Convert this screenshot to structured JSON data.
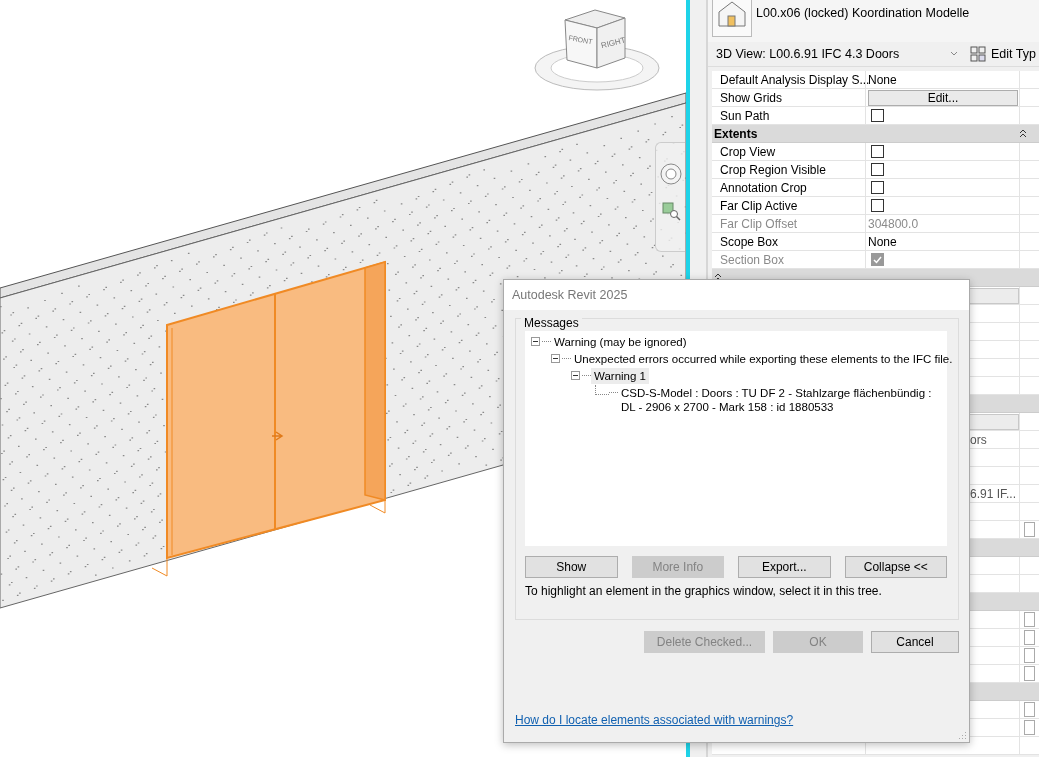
{
  "viewport": {
    "viewcube_faces": [
      "FRONT",
      "RIGHT"
    ]
  },
  "properties": {
    "view_name": "L00.x06 (locked) Koordination Modelle",
    "type_selector": "3D View: L00.6.91 IFC 4.3 Doors",
    "edit_type": "Edit Typ",
    "rows": [
      {
        "kind": "text",
        "label": "Default Analysis Display S...",
        "value": "None",
        "disabled": false
      },
      {
        "kind": "button",
        "label": "Show Grids",
        "value": "Edit...",
        "disabled": false
      },
      {
        "kind": "checkbox",
        "label": "Sun Path",
        "checked": false,
        "disabled": false
      },
      {
        "kind": "section",
        "label": "Extents"
      },
      {
        "kind": "checkbox",
        "label": "Crop View",
        "checked": false,
        "disabled": false
      },
      {
        "kind": "checkbox",
        "label": "Crop Region Visible",
        "checked": false,
        "disabled": false
      },
      {
        "kind": "checkbox",
        "label": "Annotation Crop",
        "checked": false,
        "disabled": false
      },
      {
        "kind": "checkbox",
        "label": "Far Clip Active",
        "checked": false,
        "disabled": false
      },
      {
        "kind": "text",
        "label": "Far Clip Offset",
        "value": "304800.0",
        "disabled": true
      },
      {
        "kind": "text",
        "label": "Scope Box",
        "value": "None",
        "disabled": false
      },
      {
        "kind": "checkbox",
        "label": "Section Box",
        "checked": true,
        "disabled": true
      },
      {
        "kind": "section"
      },
      {
        "kind": "field"
      },
      {
        "kind": "blank"
      },
      {
        "kind": "blank"
      },
      {
        "kind": "blank"
      },
      {
        "kind": "blank"
      },
      {
        "kind": "blank"
      },
      {
        "kind": "section"
      },
      {
        "kind": "field"
      },
      {
        "kind": "tail",
        "value": "ors"
      },
      {
        "kind": "blank"
      },
      {
        "kind": "blank"
      },
      {
        "kind": "tail",
        "value": "6.91 IF..."
      },
      {
        "kind": "blank"
      },
      {
        "kind": "edgebox",
        "checked": false
      },
      {
        "kind": "section"
      },
      {
        "kind": "blank"
      },
      {
        "kind": "blank"
      },
      {
        "kind": "section"
      },
      {
        "kind": "edgebox",
        "checked": false
      },
      {
        "kind": "edgebox",
        "checked": false
      },
      {
        "kind": "edgebox",
        "checked": false
      },
      {
        "kind": "edgebox",
        "checked": false
      },
      {
        "kind": "section"
      },
      {
        "kind": "edgebox",
        "checked": false
      },
      {
        "kind": "edgebox",
        "checked": false
      },
      {
        "kind": "blank"
      }
    ]
  },
  "dialog": {
    "title": "Autodesk Revit 2025",
    "group_label": "Messages",
    "tree": [
      {
        "text": "Warning (may be ignored)",
        "expanded": true,
        "selected": false,
        "children": [
          {
            "text": "Unexpected errors occurred while exporting these elements to the IFC file.",
            "expanded": true,
            "selected": false,
            "children": [
              {
                "text": "Warning 1",
                "expanded": true,
                "selected": true,
                "children": [
                  {
                    "text": "CSD-S-Model : Doors : TU DF 2 - Stahlzarge flächenbündig : DL - 2906 x 2700 - Mark 158 : id 1880533",
                    "selected": false
                  }
                ]
              }
            ]
          }
        ]
      }
    ],
    "tree_buttons": [
      {
        "label": "Show",
        "disabled": false
      },
      {
        "label": "More Info",
        "disabled": true
      },
      {
        "label": "Export...",
        "disabled": false
      },
      {
        "label": "Collapse <<",
        "disabled": false
      }
    ],
    "hint": "To highlight an element in the graphics window, select it in this tree.",
    "buttons": [
      {
        "label": "Delete Checked...",
        "disabled": true
      },
      {
        "label": "OK",
        "disabled": true
      },
      {
        "label": "Cancel",
        "disabled": false
      }
    ],
    "help_link": "How do I locate elements associated with warnings?"
  }
}
